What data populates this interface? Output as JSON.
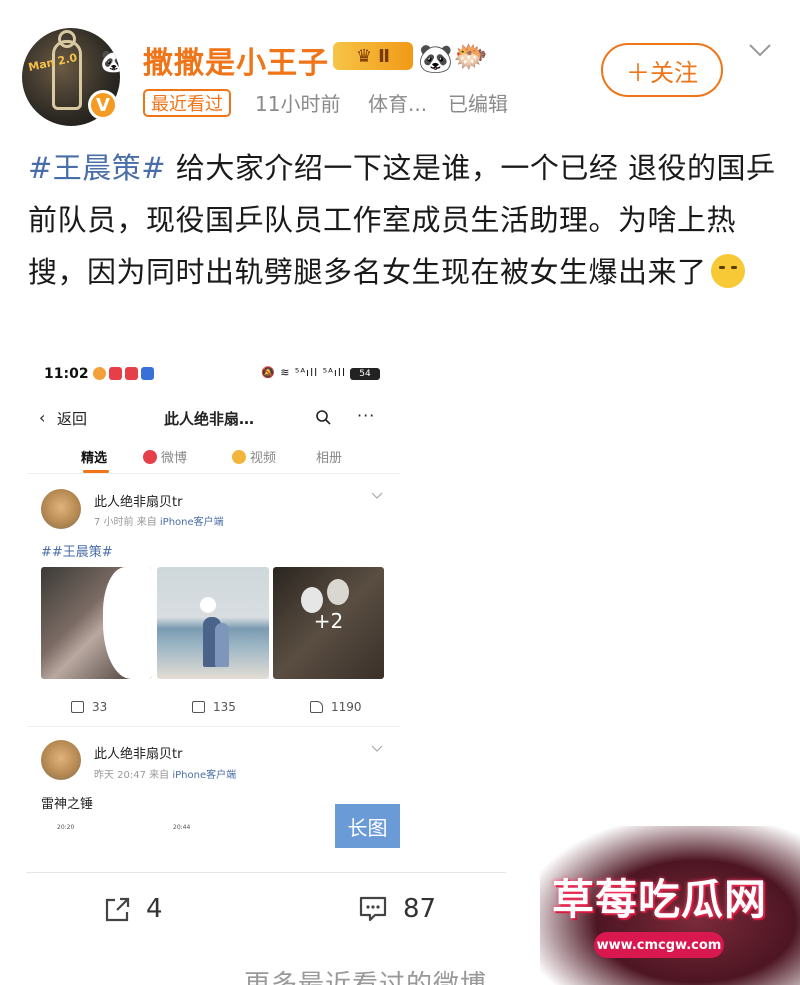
{
  "post": {
    "username": "撒撒是小王子",
    "level_badge": "Ⅱ",
    "recent_tag": "最近看过",
    "time": "11小时前",
    "source": "体育...",
    "edited": "已编辑",
    "follow_label": "＋关注",
    "text_hashtag": "#王晨策#",
    "text_body": " 给大家介绍一下这是谁，一个已经 退役的国乒前队员，现役国乒队员工作室成员生活助理。为啥上热搜，因为同时出轨劈腿多名女生现在被女生爆出来了",
    "avatar_text": "Man 2.0"
  },
  "embed": {
    "status_time": "11:02",
    "status_right": "🔕 ≋ ⁵ᴬıll ⁵ᴬıll",
    "battery": "54",
    "back_arrow": "‹",
    "back_label": "返回",
    "title": "此人绝非扇…",
    "more": "···",
    "tabs": [
      {
        "label": "精选"
      },
      {
        "label": "微博"
      },
      {
        "label": "视频"
      },
      {
        "label": "相册"
      }
    ],
    "card1": {
      "name": "此人绝非扇贝tr",
      "meta_time": "7 小时前  来自 ",
      "meta_source": "iPhone客户端",
      "text": "##王晨策#",
      "plus_more": "+2",
      "share_count": "33",
      "comment_count": "135",
      "like_count": "1190"
    },
    "card2": {
      "name": "此人绝非扇贝tr",
      "meta_time": "昨天 20:47  来自 ",
      "meta_source": "iPhone客户端",
      "text": "雷神之锤",
      "mini_time_1": "20:20",
      "mini_time_2": "20:44"
    },
    "long_image_label": "长图"
  },
  "actions": {
    "share_count": "4",
    "comment_count": "87"
  },
  "more_recent": "更多最近看过的微博",
  "watermark": {
    "title": "草莓吃瓜网",
    "url": "www.cmcgw.com"
  },
  "colors": {
    "accent_orange": "#f07418",
    "link_blue": "#4a6ea8",
    "watermark_red": "#d9184f"
  },
  "icons": [
    "verified-icon",
    "panda-icon",
    "fish-icon",
    "chevron-down-icon",
    "search-icon",
    "more-icon",
    "share-icon",
    "comment-icon",
    "like-icon"
  ]
}
